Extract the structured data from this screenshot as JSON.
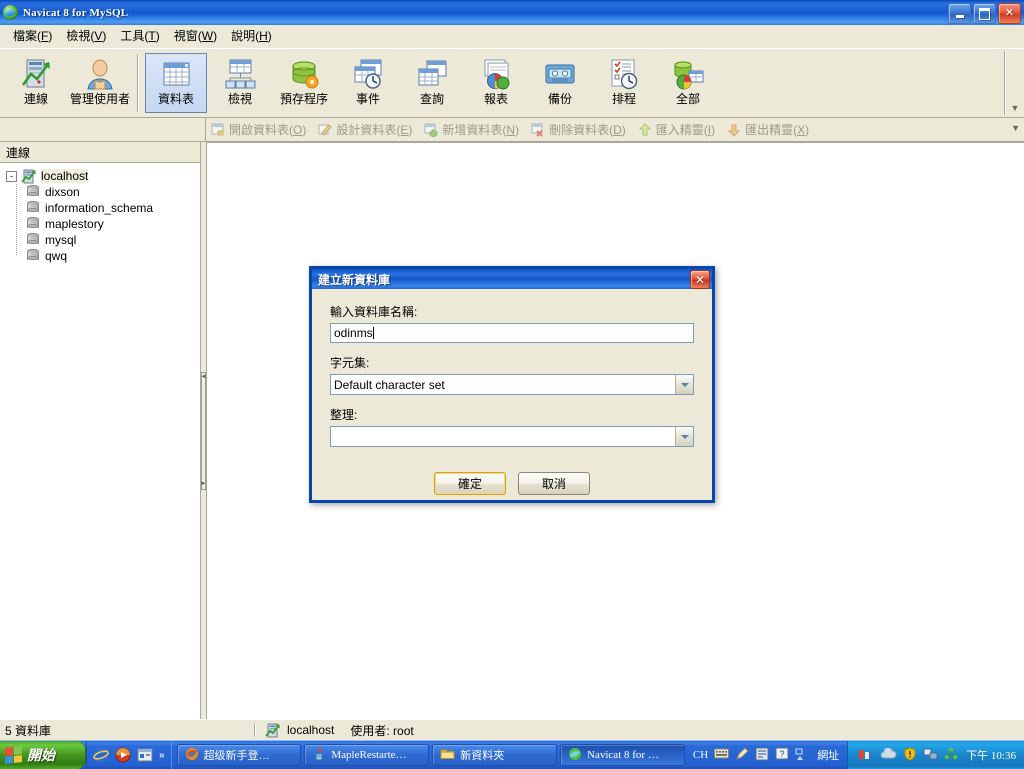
{
  "window": {
    "title": "Navicat 8 for MySQL",
    "icon": "navicat-logo-icon",
    "buttons": {
      "minimize": "minimize-icon",
      "maximize": "maximize-icon",
      "close": "close-icon"
    }
  },
  "menubar": [
    {
      "label": "檔案",
      "accel": "F"
    },
    {
      "label": "檢視",
      "accel": "V"
    },
    {
      "label": "工具",
      "accel": "T"
    },
    {
      "label": "視窗",
      "accel": "W"
    },
    {
      "label": "說明",
      "accel": "H"
    }
  ],
  "toolbar": {
    "overflow": "▼",
    "groups": [
      {
        "items": [
          {
            "label": "連線",
            "icon": "connection-icon",
            "active": false
          },
          {
            "label": "管理使用者",
            "icon": "manage-users-icon",
            "active": false
          }
        ]
      },
      {
        "items": [
          {
            "label": "資料表",
            "icon": "tables-icon",
            "active": true
          },
          {
            "label": "檢視",
            "icon": "views-icon",
            "active": false
          },
          {
            "label": "預存程序",
            "icon": "stored-procedures-icon",
            "active": false
          },
          {
            "label": "事件",
            "icon": "events-icon",
            "active": false
          },
          {
            "label": "查詢",
            "icon": "queries-icon",
            "active": false
          },
          {
            "label": "報表",
            "icon": "reports-icon",
            "active": false
          },
          {
            "label": "備份",
            "icon": "backup-icon",
            "active": false
          },
          {
            "label": "排程",
            "icon": "schedule-icon",
            "active": false
          },
          {
            "label": "全部",
            "icon": "all-icon",
            "active": false
          }
        ]
      }
    ]
  },
  "toolbar2": {
    "overflow": "▼",
    "items": [
      {
        "label": "開啟資料表",
        "accel": "O",
        "icon": "open-table-icon",
        "disabled": true
      },
      {
        "label": "設計資料表",
        "accel": "E",
        "icon": "design-table-icon",
        "disabled": true
      },
      {
        "label": "新增資料表",
        "accel": "N",
        "icon": "new-table-icon",
        "disabled": true
      },
      {
        "label": "刪除資料表",
        "accel": "D",
        "icon": "delete-table-icon",
        "disabled": true
      },
      {
        "label": "匯入精靈",
        "accel": "I",
        "icon": "import-wizard-icon",
        "disabled": true
      },
      {
        "label": "匯出精靈",
        "accel": "X",
        "icon": "export-wizard-icon",
        "disabled": true
      }
    ]
  },
  "sidebar": {
    "header": "連線",
    "root": {
      "label": "localhost",
      "icon": "connection-icon",
      "expander": "-",
      "selected": true
    },
    "databases": [
      {
        "label": "dixson",
        "icon": "database-icon"
      },
      {
        "label": "information_schema",
        "icon": "database-icon"
      },
      {
        "label": "maplestory",
        "icon": "database-icon"
      },
      {
        "label": "mysql",
        "icon": "database-icon"
      },
      {
        "label": "qwq",
        "icon": "database-icon"
      }
    ]
  },
  "statusbar": {
    "count_text": "5 資料庫",
    "connection_icon": "connection-icon",
    "connection": "localhost",
    "user": "使用者: root"
  },
  "dialog": {
    "title": "建立新資料庫",
    "close_icon": "close-icon",
    "name_label": "輸入資料庫名稱:",
    "name_value": "odinms",
    "charset_label": "字元集:",
    "charset_value": "Default character set",
    "collation_label": "整理:",
    "collation_value": "",
    "ok_label": "確定",
    "cancel_label": "取消"
  },
  "taskbar": {
    "start_label": "開始",
    "start_icon": "windows-flag-icon",
    "quicklaunch": [
      {
        "icon": "internet-explorer-icon"
      },
      {
        "icon": "media-player-icon"
      },
      {
        "icon": "show-desktop-icon"
      }
    ],
    "quicklaunch_overflow": "»",
    "tasks": [
      {
        "label": "超级新手登…",
        "icon": "firefox-icon",
        "active": false
      },
      {
        "label": "MapleRestarte…",
        "icon": "java-icon",
        "active": false
      },
      {
        "label": "新資料夾",
        "icon": "folder-icon",
        "active": false
      },
      {
        "label": "Navicat 8 for …",
        "icon": "navicat-logo-icon",
        "active": true
      }
    ],
    "langbar": {
      "lang": "CH",
      "icons": [
        "keyboard-icon",
        "pen-icon",
        "ime-pad-icon",
        "help-icon",
        "toolbar-handle-icon"
      ],
      "address_label": "網址"
    },
    "tray": {
      "icons": [
        "network-activity-icon",
        "cloud-icon",
        "security-alert-icon",
        "network-icon",
        "connections-icon"
      ],
      "clock": "下午 10:36"
    }
  },
  "colors": {
    "titlebar_blue": "#0a52c8",
    "face": "#ece9d8",
    "selection_blue": "#316ac5",
    "taskbar_blue": "#245edb",
    "start_green": "#3f8f22"
  }
}
